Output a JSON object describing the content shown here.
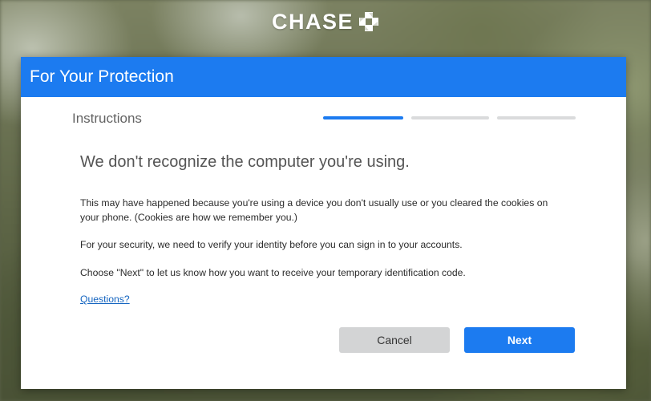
{
  "brand": {
    "name": "CHASE",
    "logo_icon": "chase-octagon-icon"
  },
  "dialog": {
    "title": "For Your Protection",
    "step_label": "Instructions",
    "progress": {
      "total_steps": 3,
      "current_step": 1
    },
    "headline": "We don't recognize the computer you're using.",
    "paragraphs": [
      "This may have happened because you're using a device you don't usually use or you cleared the cookies on your phone. (Cookies are how we remember you.)",
      "For your security, we need to verify your identity before you can sign in to your accounts.",
      "Choose \"Next\" to let us know how you want to receive your temporary identification code."
    ],
    "help_link": "Questions?",
    "buttons": {
      "cancel": "Cancel",
      "next": "Next"
    }
  },
  "colors": {
    "accent": "#1c7bf0",
    "cancel_bg": "#d3d4d5",
    "link": "#1565c0"
  }
}
